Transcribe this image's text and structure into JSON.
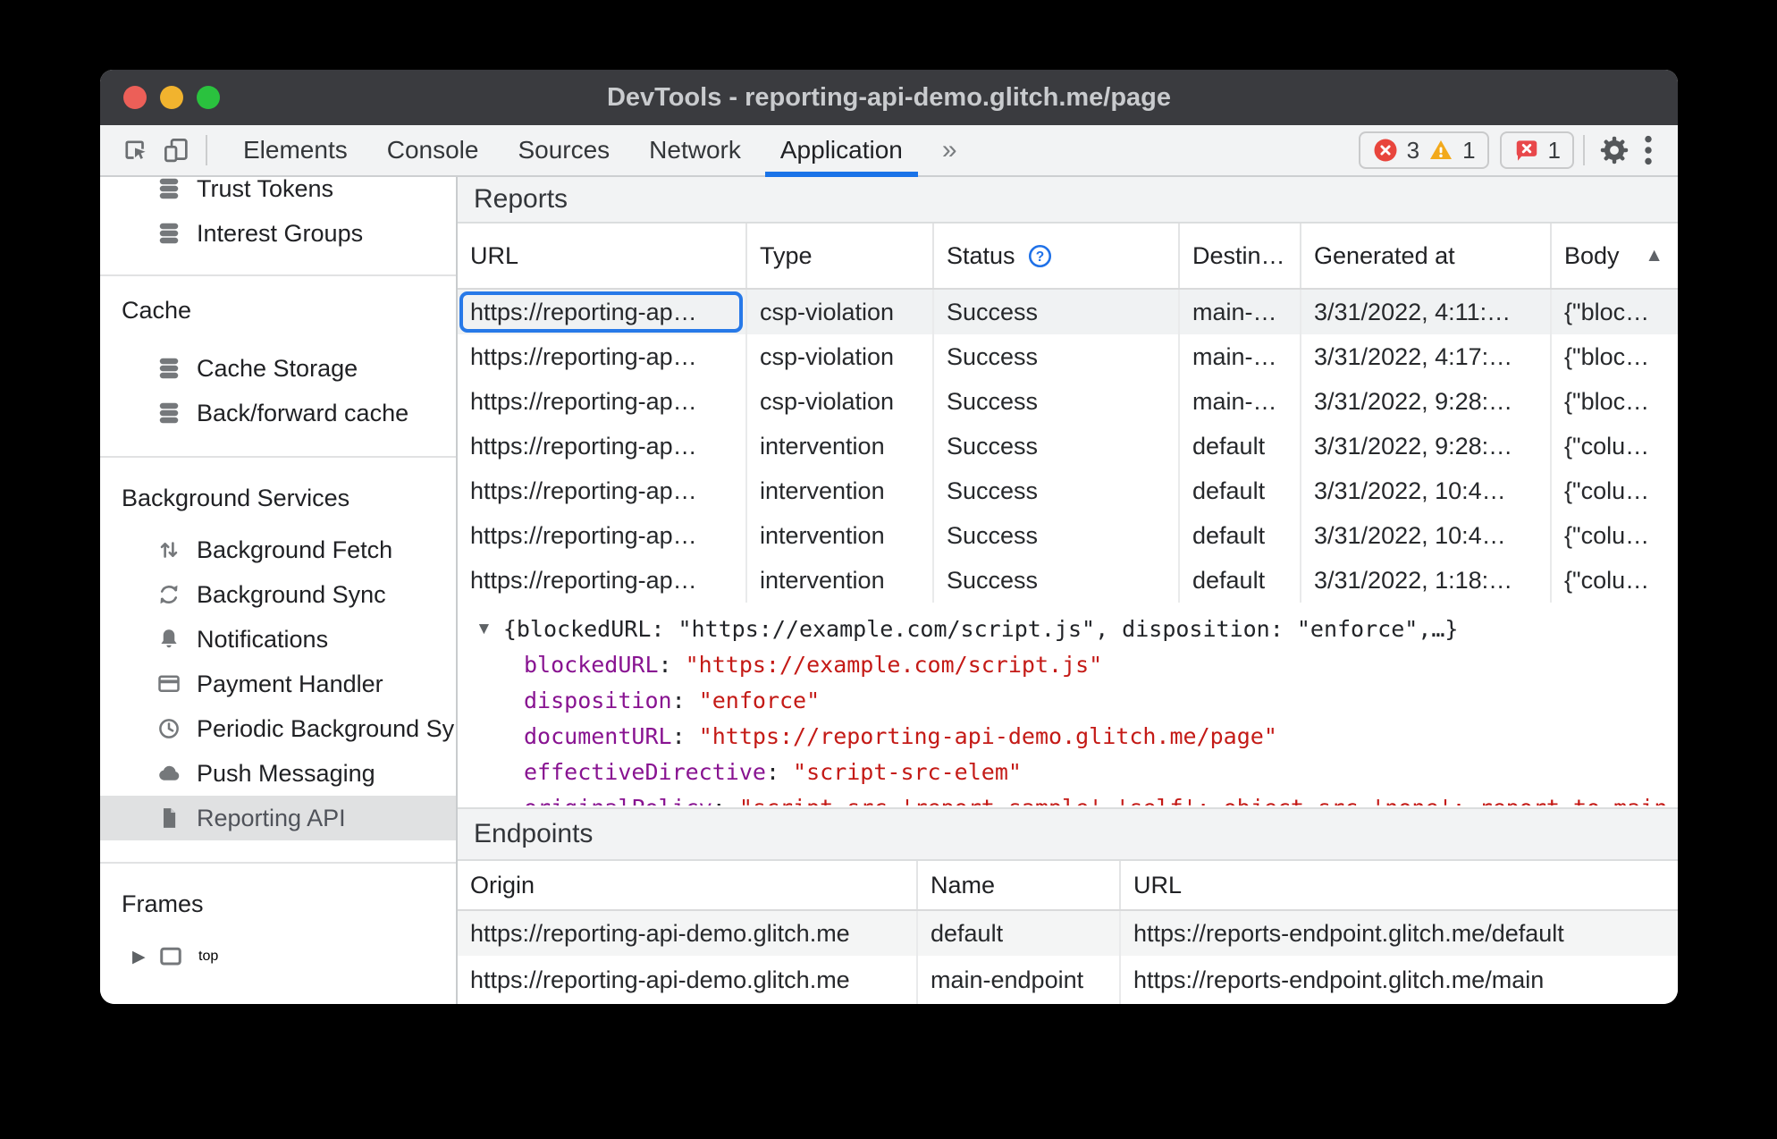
{
  "window": {
    "title": "DevTools - reporting-api-demo.glitch.me/page"
  },
  "toolbar": {
    "tabs": [
      {
        "label": "Elements"
      },
      {
        "label": "Console"
      },
      {
        "label": "Sources"
      },
      {
        "label": "Network"
      },
      {
        "label": "Application"
      }
    ],
    "more_tabs": "»",
    "error_count": "3",
    "warning_count": "1",
    "issue_count": "1"
  },
  "sidebar": {
    "sections": [
      {
        "items": [
          {
            "label": "Trust Tokens"
          },
          {
            "label": "Interest Groups"
          }
        ]
      },
      {
        "header": "Cache",
        "items": [
          {
            "label": "Cache Storage"
          },
          {
            "label": "Back/forward cache"
          }
        ]
      },
      {
        "header": "Background Services",
        "items": [
          {
            "label": "Background Fetch"
          },
          {
            "label": "Background Sync"
          },
          {
            "label": "Notifications"
          },
          {
            "label": "Payment Handler"
          },
          {
            "label": "Periodic Background Sync"
          },
          {
            "label": "Push Messaging"
          },
          {
            "label": "Reporting API"
          }
        ]
      },
      {
        "header": "Frames",
        "items": [
          {
            "label": "top"
          }
        ]
      }
    ]
  },
  "reports": {
    "title": "Reports",
    "columns": {
      "url": "URL",
      "type": "Type",
      "status": "Status",
      "destination": "Destin…",
      "generated": "Generated at",
      "body": "Body"
    },
    "sort_indicator": "▲",
    "rows": [
      {
        "url": "https://reporting-ap…",
        "type": "csp-violation",
        "status": "Success",
        "destination": "main-…",
        "generated": "3/31/2022, 4:11:…",
        "body": "{\"bloc…"
      },
      {
        "url": "https://reporting-ap…",
        "type": "csp-violation",
        "status": "Success",
        "destination": "main-…",
        "generated": "3/31/2022, 4:17:…",
        "body": "{\"bloc…"
      },
      {
        "url": "https://reporting-ap…",
        "type": "csp-violation",
        "status": "Success",
        "destination": "main-…",
        "generated": "3/31/2022, 9:28:…",
        "body": "{\"bloc…"
      },
      {
        "url": "https://reporting-ap…",
        "type": "intervention",
        "status": "Success",
        "destination": "default",
        "generated": "3/31/2022, 9:28:…",
        "body": "{\"colu…"
      },
      {
        "url": "https://reporting-ap…",
        "type": "intervention",
        "status": "Success",
        "destination": "default",
        "generated": "3/31/2022, 10:4…",
        "body": "{\"colu…"
      },
      {
        "url": "https://reporting-ap…",
        "type": "intervention",
        "status": "Success",
        "destination": "default",
        "generated": "3/31/2022, 10:4…",
        "body": "{\"colu…"
      },
      {
        "url": "https://reporting-ap…",
        "type": "intervention",
        "status": "Success",
        "destination": "default",
        "generated": "3/31/2022, 1:18:…",
        "body": "{\"colu…"
      }
    ]
  },
  "detail": {
    "disclosure": "▼",
    "preview": "{blockedURL: \"https://example.com/script.js\", disposition: \"enforce\",…}",
    "entries": [
      {
        "key": "blockedURL",
        "value": "\"https://example.com/script.js\""
      },
      {
        "key": "disposition",
        "value": "\"enforce\""
      },
      {
        "key": "documentURL",
        "value": "\"https://reporting-api-demo.glitch.me/page\""
      },
      {
        "key": "effectiveDirective",
        "value": "\"script-src-elem\""
      }
    ],
    "clipped_entry": {
      "key": "originalPolicy",
      "value": "\"script-src 'report-sample' 'self'; object-src 'none'; report-to main-endpoint\""
    }
  },
  "endpoints": {
    "title": "Endpoints",
    "columns": {
      "origin": "Origin",
      "name": "Name",
      "url": "URL"
    },
    "rows": [
      {
        "origin": "https://reporting-api-demo.glitch.me",
        "name": "default",
        "url": "https://reports-endpoint.glitch.me/default"
      },
      {
        "origin": "https://reporting-api-demo.glitch.me",
        "name": "main-endpoint",
        "url": "https://reports-endpoint.glitch.me/main"
      }
    ]
  }
}
